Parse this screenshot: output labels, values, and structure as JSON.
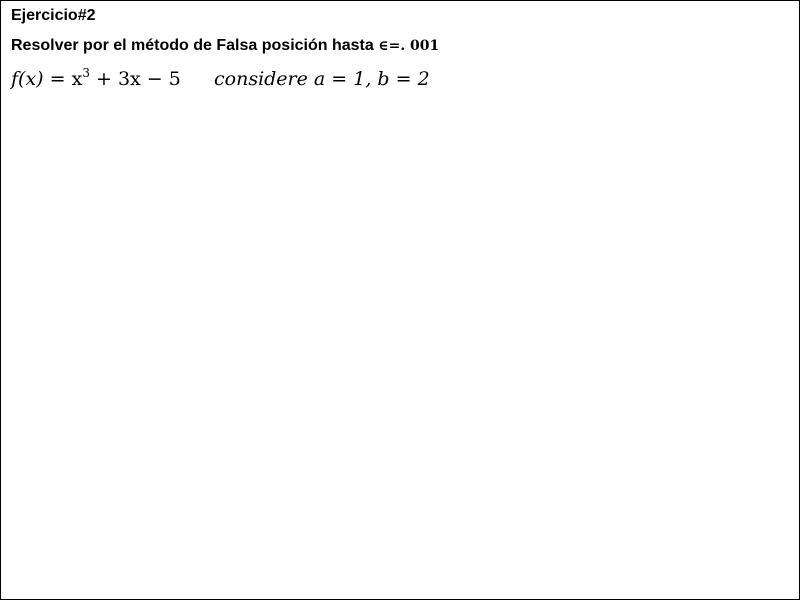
{
  "document": {
    "title": "Ejercicio#2",
    "instruction": {
      "text": "Resolver por el método de Falsa posición hasta",
      "tolerance": "∈=. 001"
    },
    "equation": {
      "function_lhs": "f(x)",
      "function_rhs_base": "= x",
      "function_rhs_exp": "3",
      "function_rhs_rest": "+ 3x − 5",
      "condition": "considere a = 1, b = 2"
    }
  }
}
